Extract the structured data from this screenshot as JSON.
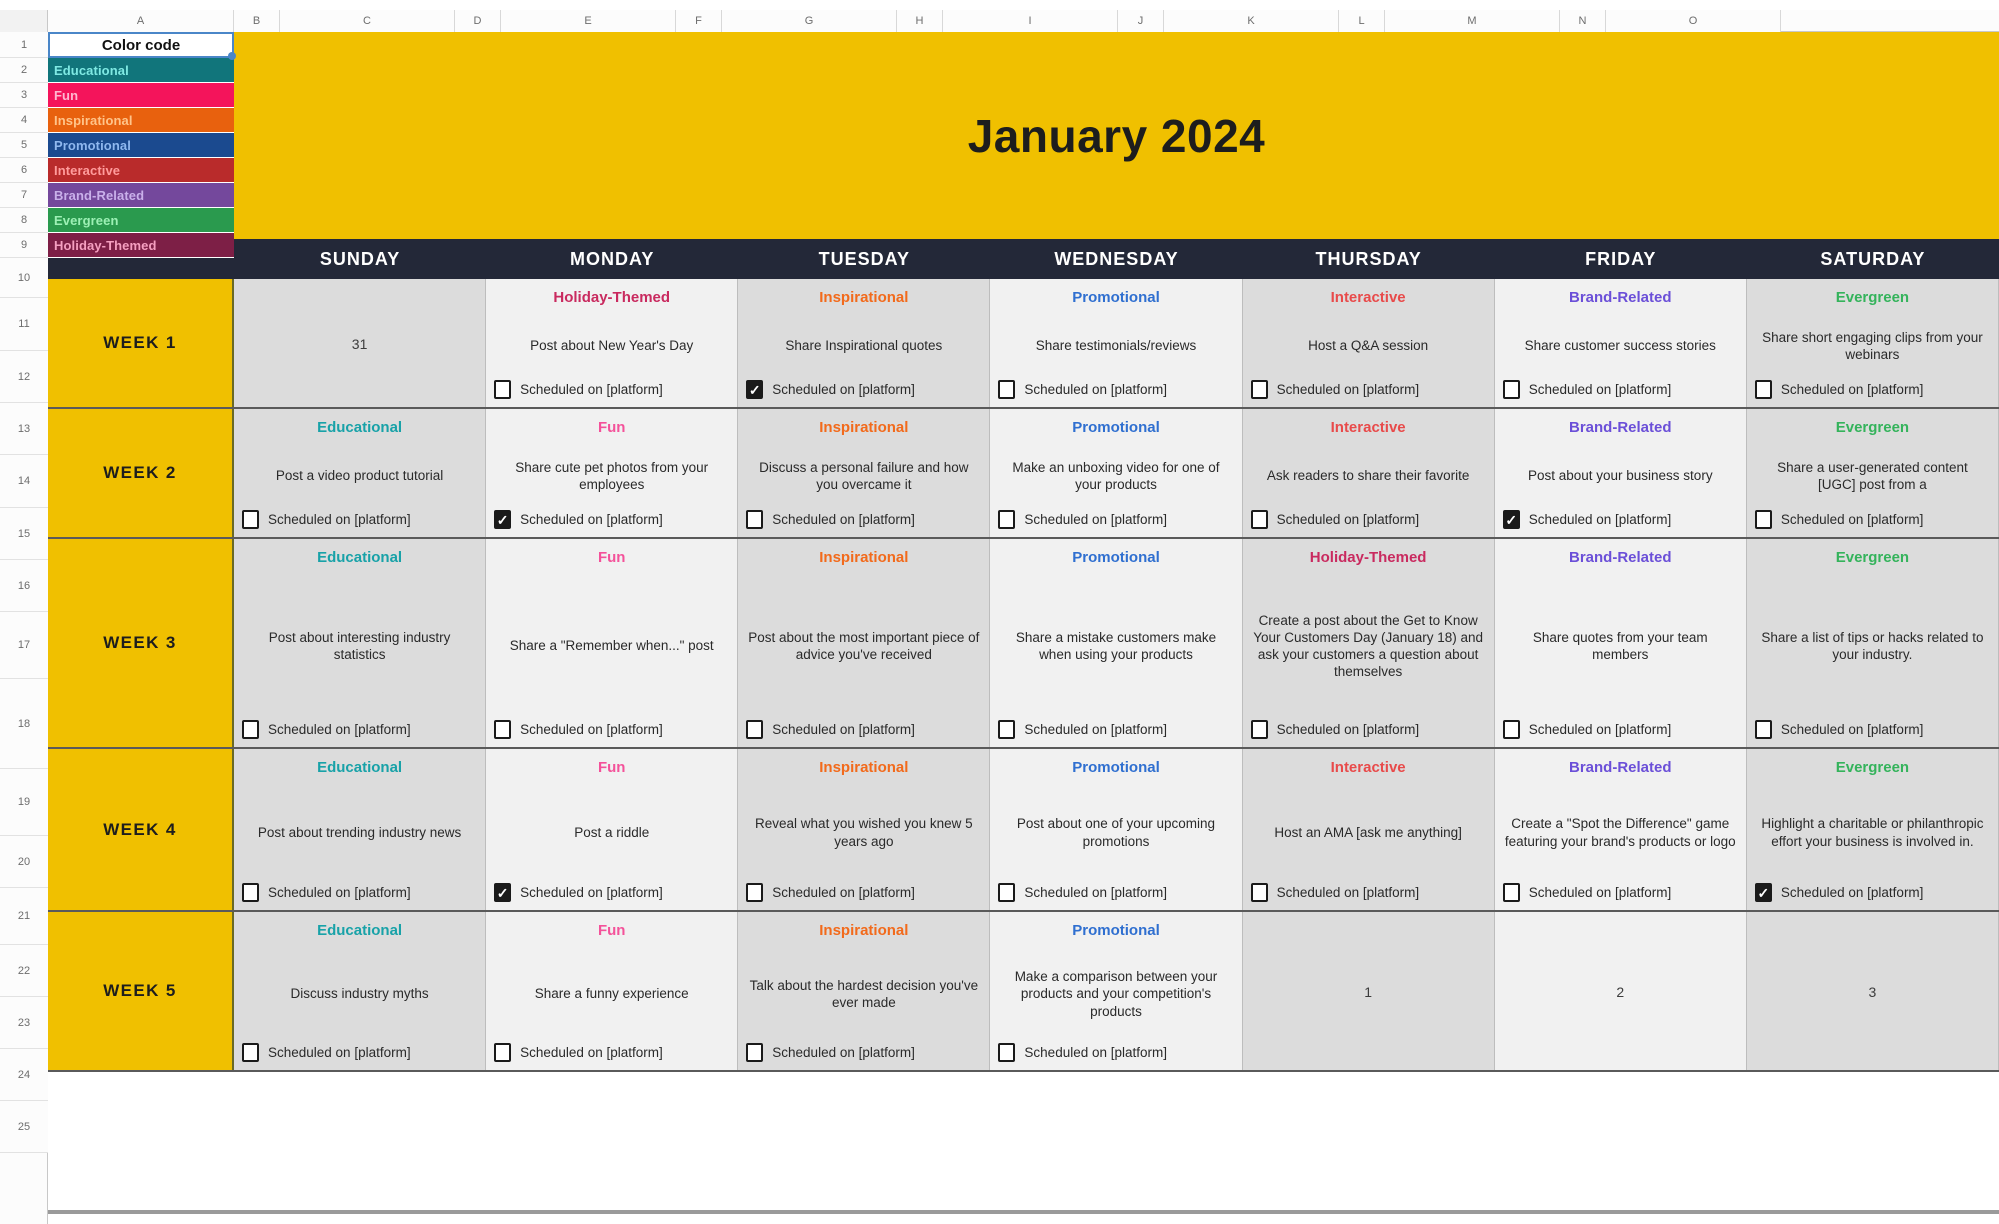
{
  "spreadsheet": {
    "column_headers": [
      "A",
      "B",
      "C",
      "D",
      "E",
      "F",
      "G",
      "H",
      "I",
      "J",
      "K",
      "L",
      "M",
      "N",
      "O"
    ],
    "row_headers": [
      "1",
      "2",
      "3",
      "4",
      "5",
      "6",
      "7",
      "8",
      "9",
      "10",
      "11",
      "12",
      "13",
      "14",
      "15",
      "16",
      "17",
      "18",
      "19",
      "20",
      "21",
      "22",
      "23",
      "24",
      "25"
    ]
  },
  "legend": {
    "title": "Color code",
    "items": [
      {
        "label": "Educational",
        "bg": "#11757b",
        "fg": "#7fe9e3"
      },
      {
        "label": "Fun",
        "bg": "#f4145b",
        "fg": "#ffb7d0"
      },
      {
        "label": "Inspirational",
        "bg": "#e8610e",
        "fg": "#ffc48a"
      },
      {
        "label": "Promotional",
        "bg": "#1b4a8f",
        "fg": "#8fb8ef"
      },
      {
        "label": "Interactive",
        "bg": "#b92b2b",
        "fg": "#ff9c9c"
      },
      {
        "label": "Brand-Related",
        "bg": "#74489c",
        "fg": "#c9b0ea"
      },
      {
        "label": "Evergreen",
        "bg": "#2a9a4e",
        "fg": "#9df0b5"
      },
      {
        "label": "Holiday-Themed",
        "bg": "#7d1f46",
        "fg": "#f59fc0"
      }
    ]
  },
  "banner": {
    "title": "January 2024",
    "bg": "#f0c000"
  },
  "calendar": {
    "days": [
      "SUNDAY",
      "MONDAY",
      "TUESDAY",
      "WEDNESDAY",
      "THURSDAY",
      "FRIDAY",
      "SATURDAY"
    ],
    "scheduled_label": "Scheduled on [platform]",
    "category_colors": {
      "Educational": "#18a2a8",
      "Fun": "#f4529a",
      "Inspirational": "#f26a1b",
      "Promotional": "#2f6fd0",
      "Interactive": "#e84a4a",
      "Brand-Related": "#6b4fd8",
      "Evergreen": "#34b35b",
      "Holiday-Themed": "#c92a5f"
    },
    "weeks": [
      {
        "label": "WEEK 1",
        "cells": [
          {
            "kind": "daynum",
            "number": "31"
          },
          {
            "kind": "post",
            "category": "Holiday-Themed",
            "description": "Post about New Year's Day",
            "checked": false
          },
          {
            "kind": "post",
            "category": "Inspirational",
            "description": "Share Inspirational quotes",
            "checked": true
          },
          {
            "kind": "post",
            "category": "Promotional",
            "description": "Share testimonials/reviews",
            "checked": false
          },
          {
            "kind": "post",
            "category": "Interactive",
            "description": "Host a Q&A session",
            "checked": false
          },
          {
            "kind": "post",
            "category": "Brand-Related",
            "description": "Share customer success stories",
            "checked": false
          },
          {
            "kind": "post",
            "category": "Evergreen",
            "description": "Share short engaging clips from your webinars",
            "checked": false
          }
        ]
      },
      {
        "label": "WEEK 2",
        "cells": [
          {
            "kind": "post",
            "category": "Educational",
            "description": "Post a video product tutorial",
            "checked": false
          },
          {
            "kind": "post",
            "category": "Fun",
            "description": "Share cute pet photos from your employees",
            "checked": true
          },
          {
            "kind": "post",
            "category": "Inspirational",
            "description": "Discuss a personal failure and how you overcame it",
            "checked": false
          },
          {
            "kind": "post",
            "category": "Promotional",
            "description": "Make an unboxing video for one of your products",
            "checked": false
          },
          {
            "kind": "post",
            "category": "Interactive",
            "description": "Ask readers to share their favorite",
            "checked": false
          },
          {
            "kind": "post",
            "category": "Brand-Related",
            "description": "Post about your business story",
            "checked": true
          },
          {
            "kind": "post",
            "category": "Evergreen",
            "description": "Share a user-generated content [UGC] post from a",
            "checked": false
          }
        ]
      },
      {
        "label": "WEEK 3",
        "cells": [
          {
            "kind": "post",
            "category": "Educational",
            "description": "Post about interesting industry statistics",
            "checked": false
          },
          {
            "kind": "post",
            "category": "Fun",
            "description": "Share a \"Remember when...\" post",
            "checked": false
          },
          {
            "kind": "post",
            "category": "Inspirational",
            "description": "Post about the most important piece of advice you've received",
            "checked": false
          },
          {
            "kind": "post",
            "category": "Promotional",
            "description": "Share a mistake customers make when using your products",
            "checked": false
          },
          {
            "kind": "post",
            "category": "Holiday-Themed",
            "description": "Create a post about the Get to Know Your Customers Day (January 18) and ask your customers a question about themselves",
            "checked": false
          },
          {
            "kind": "post",
            "category": "Brand-Related",
            "description": "Share quotes from your team members",
            "checked": false
          },
          {
            "kind": "post",
            "category": "Evergreen",
            "description": "Share a list of tips or hacks related to your industry.",
            "checked": false
          }
        ]
      },
      {
        "label": "WEEK 4",
        "cells": [
          {
            "kind": "post",
            "category": "Educational",
            "description": "Post about trending industry news",
            "checked": false
          },
          {
            "kind": "post",
            "category": "Fun",
            "description": "Post a riddle",
            "checked": true
          },
          {
            "kind": "post",
            "category": "Inspirational",
            "description": "Reveal what you wished you knew 5 years ago",
            "checked": false
          },
          {
            "kind": "post",
            "category": "Promotional",
            "description": "Post about one of your upcoming promotions",
            "checked": false
          },
          {
            "kind": "post",
            "category": "Interactive",
            "description": "Host an AMA [ask me anything]",
            "checked": false
          },
          {
            "kind": "post",
            "category": "Brand-Related",
            "description": "Create a \"Spot the Difference\" game featuring your brand's products or logo",
            "checked": false
          },
          {
            "kind": "post",
            "category": "Evergreen",
            "description": "Highlight a charitable or philanthropic effort your business is involved in.",
            "checked": true
          }
        ]
      },
      {
        "label": "WEEK 5",
        "cells": [
          {
            "kind": "post",
            "category": "Educational",
            "description": "Discuss industry myths",
            "checked": false
          },
          {
            "kind": "post",
            "category": "Fun",
            "description": "Share a funny experience",
            "checked": false
          },
          {
            "kind": "post",
            "category": "Inspirational",
            "description": "Talk about the hardest decision you've ever made",
            "checked": false
          },
          {
            "kind": "post",
            "category": "Promotional",
            "description": "Make a comparison between your products and your competition's products",
            "checked": false
          },
          {
            "kind": "daynum",
            "number": "1"
          },
          {
            "kind": "daynum",
            "number": "2"
          },
          {
            "kind": "daynum",
            "number": "3"
          }
        ]
      }
    ]
  }
}
